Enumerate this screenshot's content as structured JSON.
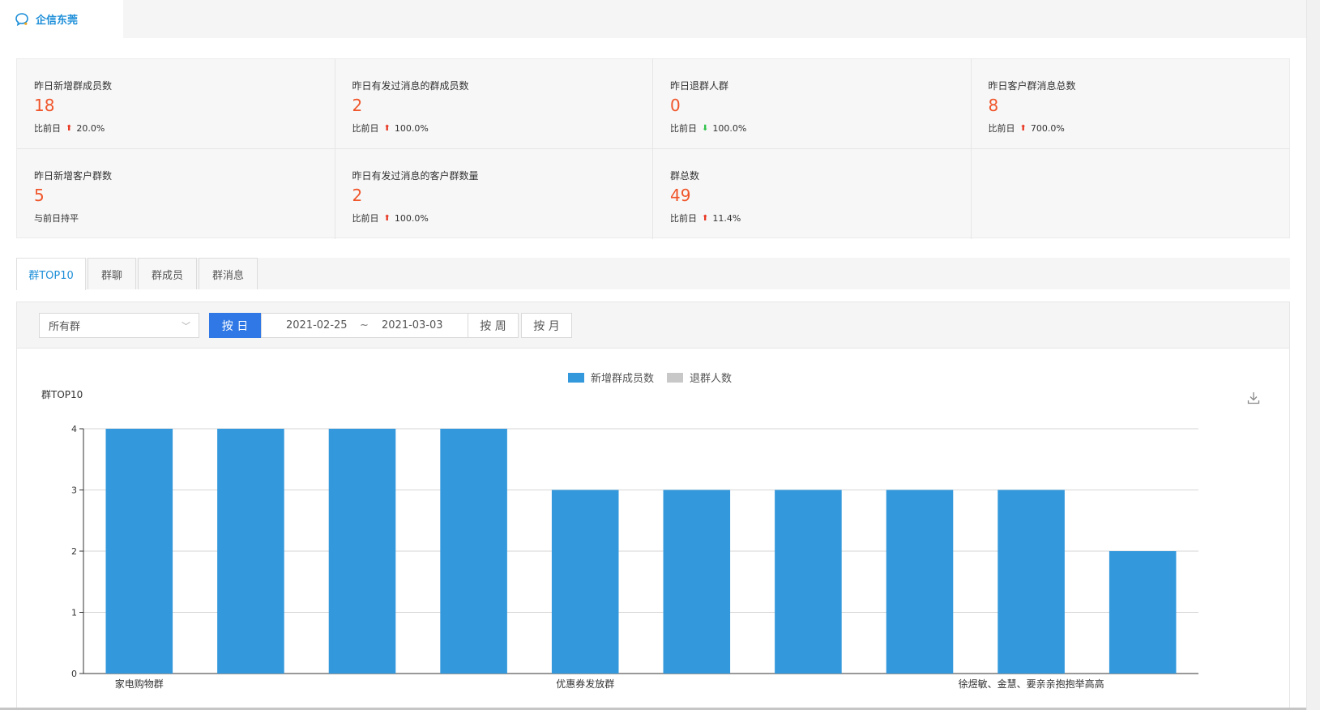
{
  "app": {
    "tab_title": "企信东莞"
  },
  "stats": [
    {
      "label": "昨日新增群成员数",
      "value": "18",
      "cmp_prefix": "比前日",
      "trend": "up",
      "cmp_value": "20.0%"
    },
    {
      "label": "昨日有发过消息的群成员数",
      "value": "2",
      "cmp_prefix": "比前日",
      "trend": "up",
      "cmp_value": "100.0%"
    },
    {
      "label": "昨日退群人群",
      "value": "0",
      "cmp_prefix": "比前日",
      "trend": "down",
      "cmp_value": "100.0%"
    },
    {
      "label": "昨日客户群消息总数",
      "value": "8",
      "cmp_prefix": "比前日",
      "trend": "up",
      "cmp_value": "700.0%"
    },
    {
      "label": "昨日新增客户群数",
      "value": "5",
      "cmp_prefix": "与前日持平",
      "trend": "none",
      "cmp_value": ""
    },
    {
      "label": "昨日有发过消息的客户群数量",
      "value": "2",
      "cmp_prefix": "比前日",
      "trend": "up",
      "cmp_value": "100.0%"
    },
    {
      "label": "群总数",
      "value": "49",
      "cmp_prefix": "比前日",
      "trend": "up",
      "cmp_value": "11.4%"
    }
  ],
  "tabs": [
    {
      "label": "群TOP10",
      "active": true
    },
    {
      "label": "群聊",
      "active": false
    },
    {
      "label": "群成员",
      "active": false
    },
    {
      "label": "群消息",
      "active": false
    }
  ],
  "filter": {
    "group_select": "所有群",
    "by_day": "按 日",
    "date_start": "2021-02-25",
    "date_sep": "~",
    "date_end": "2021-03-03",
    "by_week": "按 周",
    "by_month": "按 月"
  },
  "colors": {
    "accent": "#1c8ed8",
    "bar_primary": "#3398dc",
    "bar_secondary": "#c8c8c8",
    "stat_value": "#f0552a",
    "btn_primary": "#2f78e6"
  },
  "chart_data": {
    "type": "bar",
    "title": "群TOP10",
    "legend_position": "top-center",
    "series": [
      {
        "name": "新增群成员数",
        "values": [
          4,
          4,
          4,
          4,
          3,
          3,
          3,
          3,
          3,
          2
        ]
      },
      {
        "name": "退群人数",
        "values": [
          0,
          0,
          0,
          0,
          0,
          0,
          0,
          0,
          0,
          0
        ]
      }
    ],
    "categories": [
      "家电购物群",
      "",
      "",
      "",
      "优惠券发放群",
      "",
      "",
      "",
      "徐煜敏、金慧、要亲亲抱抱举高高",
      ""
    ],
    "ylim": [
      0,
      4
    ],
    "yticks": [
      0,
      1,
      2,
      3,
      4
    ],
    "grid": true
  }
}
